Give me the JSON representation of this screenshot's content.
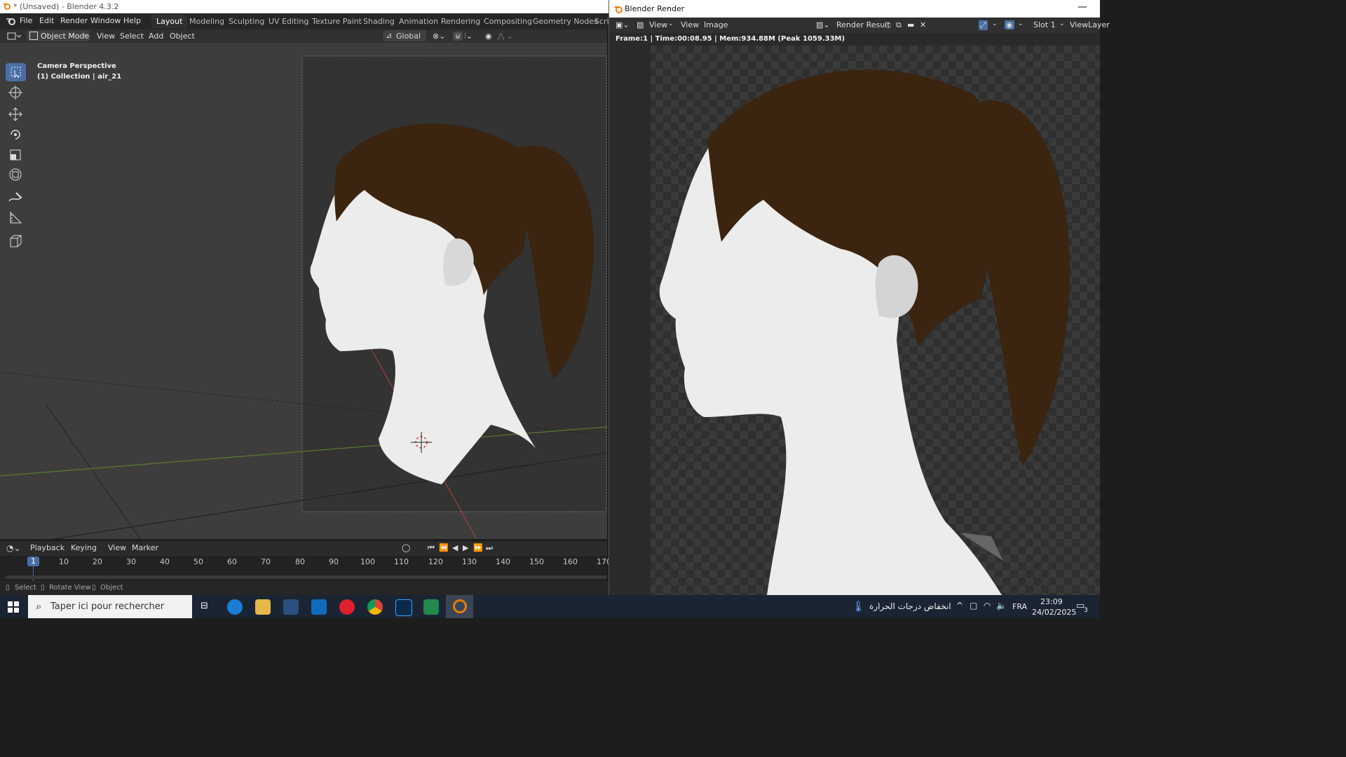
{
  "main_window": {
    "title": "* (Unsaved) - Blender 4.3.2",
    "menu": [
      "File",
      "Edit",
      "Render",
      "Window",
      "Help"
    ],
    "workspaces": [
      "Layout",
      "Modeling",
      "Sculpting",
      "UV Editing",
      "Texture Paint",
      "Shading",
      "Animation",
      "Rendering",
      "Compositing",
      "Geometry Nodes",
      "Scri"
    ],
    "active_workspace": "Layout"
  },
  "viewport_header": {
    "mode": "Object Mode",
    "menus": [
      "View",
      "Select",
      "Add",
      "Object"
    ],
    "orientation": "Global"
  },
  "viewport": {
    "overlay_line1": "Camera Perspective",
    "overlay_line2": "(1) Collection | air_21"
  },
  "toolbar": {
    "tools": [
      "select-box-icon",
      "cursor-icon",
      "move-icon",
      "rotate-icon",
      "scale-icon",
      "transform-icon",
      "annotate-icon",
      "measure-icon",
      "add-cube-icon"
    ],
    "active_tool": "select-box-icon"
  },
  "timeline": {
    "menus": [
      "Playback",
      "Keying",
      "View",
      "Marker"
    ],
    "current_frame": "1",
    "frame_labels": [
      "10",
      "20",
      "30",
      "40",
      "50",
      "60",
      "70",
      "80",
      "90",
      "100",
      "110",
      "120",
      "130",
      "140",
      "150",
      "160",
      "170"
    ]
  },
  "statusbar": {
    "items": [
      "Select",
      "Rotate View",
      "Object"
    ]
  },
  "render_window": {
    "title": "Blender Render",
    "menus": [
      "View",
      "View",
      "Image"
    ],
    "image_name": "Render Result",
    "slot": "Slot 1",
    "view_layer": "ViewLayer",
    "info": "Frame:1 | Time:00:08.95 | Mem:934.88M (Peak 1059.33M)"
  },
  "taskbar": {
    "search_placeholder": "Taper ici pour rechercher",
    "weather": "انخفاض درجات الحرارة",
    "language": "FRA",
    "time": "23:09",
    "date": "24/02/2025",
    "notifications": "3"
  },
  "colors": {
    "accent": "#4a6fa5",
    "hair": "#3b2410",
    "skin": "#ececec"
  }
}
